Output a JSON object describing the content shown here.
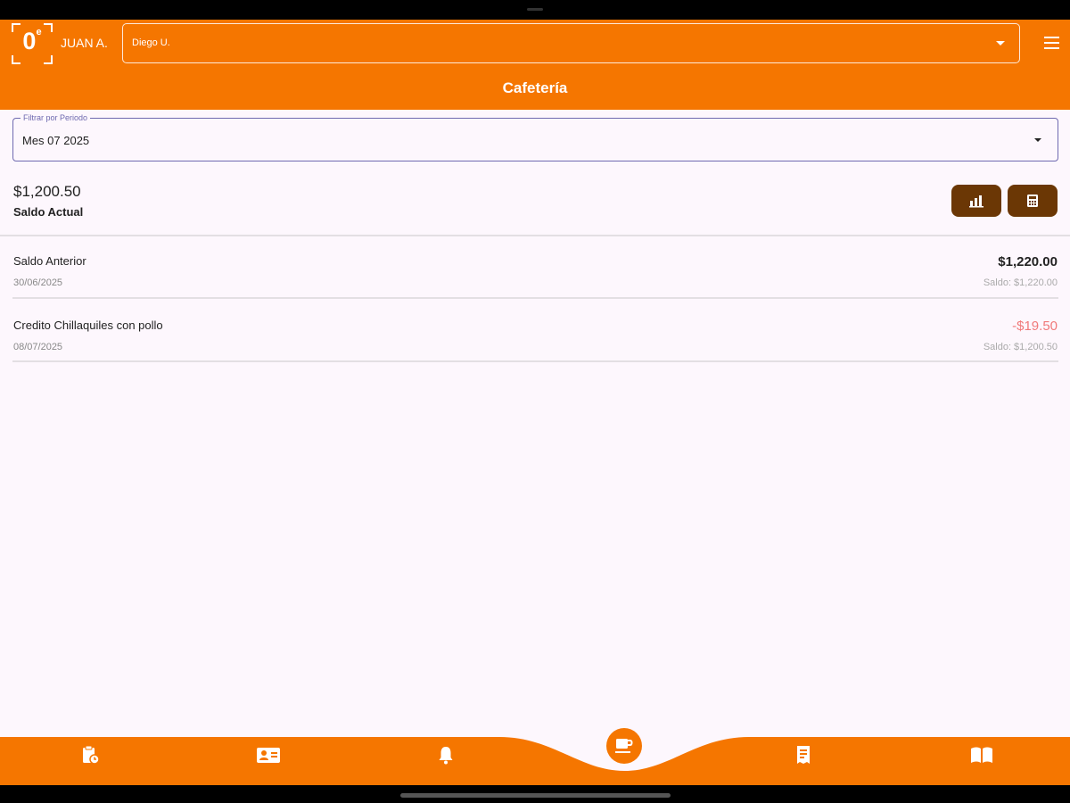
{
  "app": {
    "user_name": "JUAN A.",
    "student_select": {
      "value": "Diego U."
    },
    "page_title": "Cafetería"
  },
  "filter": {
    "label": "Filtrar por Periodo",
    "value": "Mes 07 2025"
  },
  "balance": {
    "amount": "$1,200.50",
    "label": "Saldo Actual"
  },
  "actions": [
    {
      "icon": "chart-icon"
    },
    {
      "icon": "calculator-icon"
    }
  ],
  "transactions": [
    {
      "title": "Saldo Anterior",
      "date": "30/06/2025",
      "amount": "$1,220.00",
      "saldo": "Saldo: $1,220.00",
      "color": "#222222"
    },
    {
      "title": "Credito Chillaquiles con pollo",
      "date": "08/07/2025",
      "amount": "-$19.50",
      "saldo": "Saldo: $1,200.50",
      "color": "#f07a7a"
    }
  ],
  "bottom_nav": [
    {
      "icon": "clipboard-icon"
    },
    {
      "icon": "contact-card-icon"
    },
    {
      "icon": "bell-icon"
    },
    {
      "icon": "coffee-icon",
      "active": true
    },
    {
      "icon": "receipt-icon"
    },
    {
      "icon": "book-icon"
    }
  ],
  "colors": {
    "primary": "#f57600",
    "button_dark": "#6b3705",
    "negative": "#f07a7a",
    "background": "#fdf7fd"
  }
}
